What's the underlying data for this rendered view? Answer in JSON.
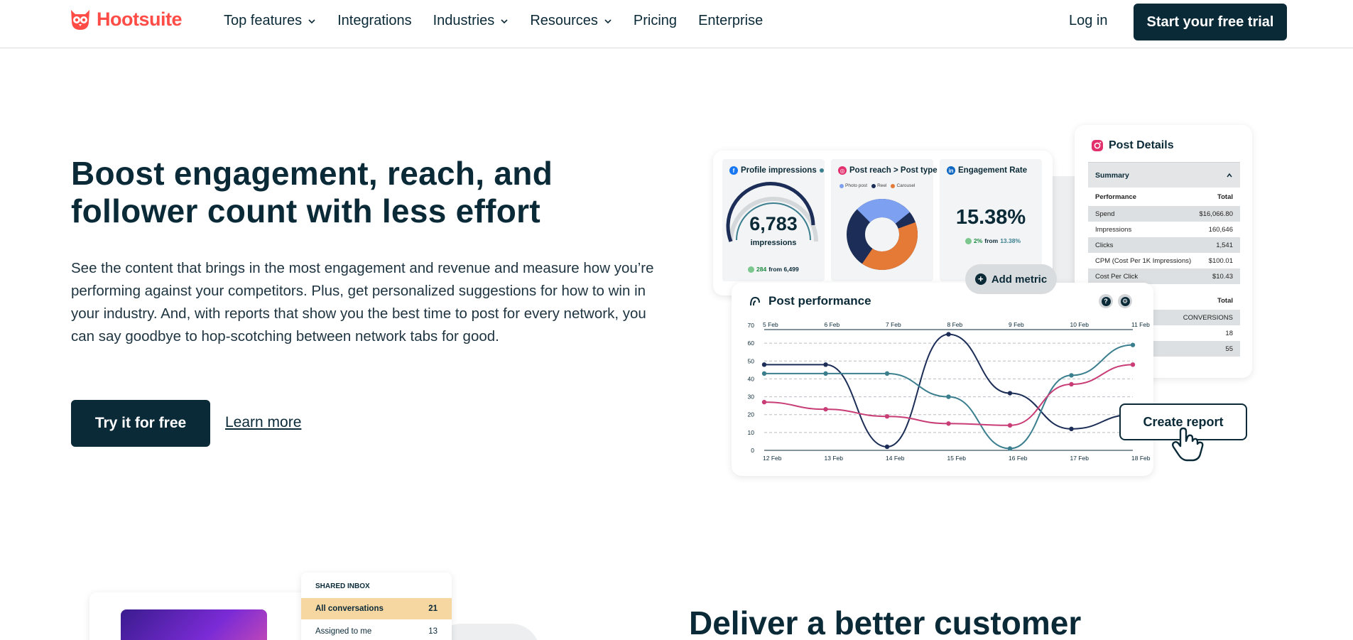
{
  "nav": {
    "logo_text": "Hootsuite",
    "items": [
      {
        "label": "Top features",
        "dropdown": true
      },
      {
        "label": "Integrations",
        "dropdown": false
      },
      {
        "label": "Industries",
        "dropdown": true
      },
      {
        "label": "Resources",
        "dropdown": true
      },
      {
        "label": "Pricing",
        "dropdown": false
      },
      {
        "label": "Enterprise",
        "dropdown": false
      }
    ],
    "login_label": "Log in",
    "trial_label": "Start your free trial"
  },
  "hero": {
    "title": "Boost engagement, reach, and follower count with less effort",
    "description": "See the content that brings in the most engagement and revenue and measure how you’re performing against your competitors. Plus, get personalized suggestions for how to win in your industry. And, with reports that show you the best time to post for every network, you can say goodbye to hop-scotching between network tabs for good.",
    "primary_cta": "Try it for free",
    "secondary_cta": "Learn more"
  },
  "dashboard": {
    "profile_impressions": {
      "title": "Profile impressions",
      "value": "6,783",
      "unit": "impressions",
      "trend_value": "284",
      "trend_text": "from 6,499"
    },
    "post_reach": {
      "title": "Post reach > Post type",
      "legend": [
        {
          "label": "Photo post",
          "color": "#7ea0f0"
        },
        {
          "label": "Reel",
          "color": "#1c2e57"
        },
        {
          "label": "Carousel",
          "color": "#e57a36"
        }
      ]
    },
    "engagement_rate": {
      "title": "Engagement Rate",
      "value": "15.38%",
      "trend_value": "2%",
      "trend_text": "from",
      "trend_from": "13.38%"
    },
    "add_metric_label": "Add metric",
    "post_details": {
      "title": "Post Details",
      "summary_label": "Summary",
      "performance_header": "Performance",
      "total_header": "Total",
      "rows": [
        {
          "label": "Spend",
          "value": "$16,066.80"
        },
        {
          "label": "Impressions",
          "value": "160,646"
        },
        {
          "label": "Clicks",
          "value": "1,541"
        },
        {
          "label": "CPM (Cost Per 1K Impressions)",
          "value": "$100.01"
        },
        {
          "label": "Cost Per Click",
          "value": "$10.43"
        }
      ],
      "second_header_total": "Total",
      "second_rows": [
        "CONVERSIONS",
        "18",
        "55"
      ]
    },
    "post_performance": {
      "title": "Post performance",
      "help_icon": "?",
      "settings_icon": "⚙"
    },
    "create_report_label": "Create report"
  },
  "chart_data": {
    "type": "line",
    "title": "Post performance",
    "top_axis_labels": [
      "5 Feb",
      "6 Feb",
      "7 Feb",
      "8 Feb",
      "9 Feb",
      "10 Feb",
      "11 Feb"
    ],
    "categories": [
      "12 Feb",
      "13 Feb",
      "14 Feb",
      "15 Feb",
      "16 Feb",
      "17 Feb",
      "18 Feb"
    ],
    "y_ticks": [
      0,
      10,
      20,
      30,
      40,
      50,
      60,
      70
    ],
    "ylim": [
      0,
      70
    ],
    "series": [
      {
        "color": "#1c2e57",
        "values": [
          48,
          48,
          2,
          65,
          32,
          12,
          20
        ]
      },
      {
        "color": "#3b7f8f",
        "values": [
          43,
          43,
          43,
          30,
          1,
          42,
          59
        ]
      },
      {
        "color": "#c93d76",
        "values": [
          27,
          23,
          19,
          15,
          14,
          37,
          48
        ]
      }
    ]
  },
  "second_section": {
    "inbox_label": "SHARED INBOX",
    "inbox_rows": [
      {
        "label": "All conversations",
        "count": "21"
      },
      {
        "label": "Assigned to me",
        "count": "13"
      }
    ],
    "title": "Deliver a better customer"
  }
}
